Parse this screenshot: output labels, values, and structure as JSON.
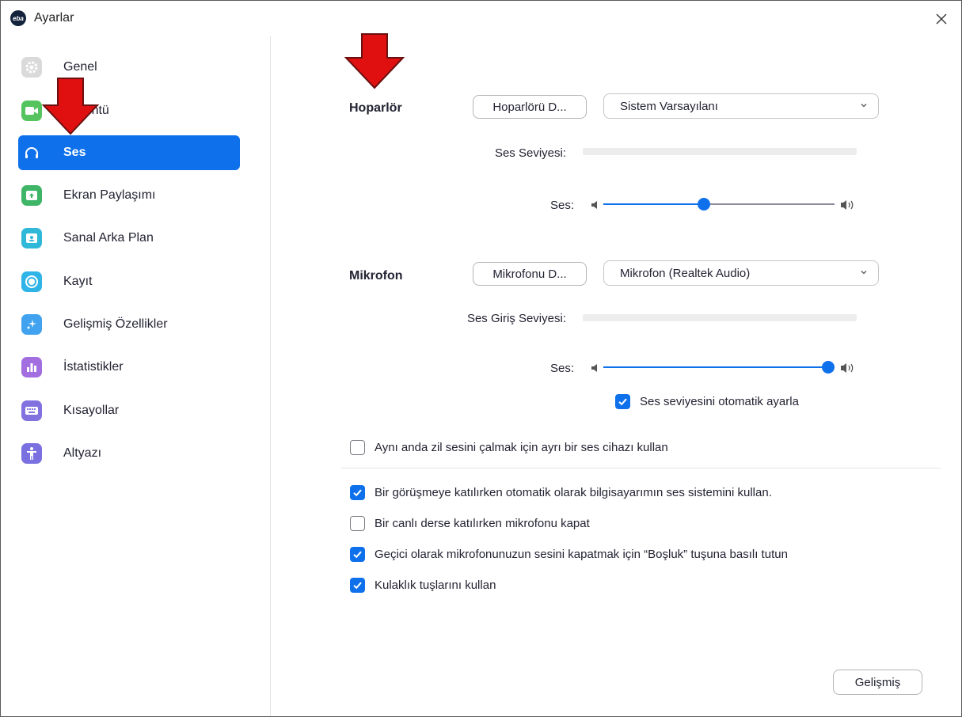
{
  "window": {
    "title": "Ayarlar",
    "app_icon_text": "eba",
    "icon": "close-icon"
  },
  "sidebar": {
    "items": [
      {
        "label": "Genel",
        "icon": "gear-icon",
        "color": "#dadada",
        "active": false
      },
      {
        "label": "Görüntü",
        "icon": "video-camera-icon",
        "color": "#55c45f",
        "active": false
      },
      {
        "label": "Ses",
        "icon": "headphones-icon",
        "color": "#0e71eb",
        "active": true
      },
      {
        "label": "Ekran Paylaşımı",
        "icon": "share-screen-icon",
        "color": "#3fb568",
        "active": false
      },
      {
        "label": "Sanal Arka Plan",
        "icon": "virtual-background-icon",
        "color": "#2fb8d8",
        "active": false
      },
      {
        "label": "Kayıt",
        "icon": "record-icon",
        "color": "#2fb4e8",
        "active": false
      },
      {
        "label": "Gelişmiş Özellikler",
        "icon": "sparkle-icon",
        "color": "#41a3ef",
        "active": false
      },
      {
        "label": "İstatistikler",
        "icon": "bar-chart-icon",
        "color": "#a36ee0",
        "active": false
      },
      {
        "label": "Kısayollar",
        "icon": "keyboard-icon",
        "color": "#8272e0",
        "active": false
      },
      {
        "label": "Altyazı",
        "icon": "accessibility-icon",
        "color": "#7a70e0",
        "active": false
      }
    ]
  },
  "speaker": {
    "label": "Hoparlör",
    "test_button": "Hoparlörü D...",
    "device": "Sistem Varsayılanı",
    "level_label": "Ses Seviyesi:",
    "volume_label": "Ses:",
    "volume": 0.43
  },
  "microphone": {
    "label": "Mikrofon",
    "test_button": "Mikrofonu D...",
    "device": "Mikrofon (Realtek Audio)",
    "level_label": "Ses Giriş Seviyesi:",
    "volume_label": "Ses:",
    "volume": 1.0,
    "auto_adjust_label": "Ses seviyesini otomatik ayarla",
    "auto_adjust": true
  },
  "options": {
    "separate_ringtone": {
      "label": "Aynı anda zil sesini çalmak için ayrı bir ses cihazı kullan",
      "checked": false
    },
    "auto_join_audio": {
      "label": "Bir görüşmeye katılırken otomatik olarak bilgisayarımın ses sistemini kullan.",
      "checked": true
    },
    "mute_mic_on_join": {
      "label": "Bir canlı derse katılırken mikrofonu kapat",
      "checked": false
    },
    "push_to_talk": {
      "label": "Geçici olarak mikrofonunuzun sesini kapatmak için “Boşluk” tuşuna basılı tutun",
      "checked": true
    },
    "headset_keys": {
      "label": "Kulaklık tuşlarını kullan",
      "checked": true
    }
  },
  "advanced_button": "Gelişmiş",
  "colors": {
    "accent": "#0e71eb",
    "annotation_arrow": "#e01010"
  }
}
